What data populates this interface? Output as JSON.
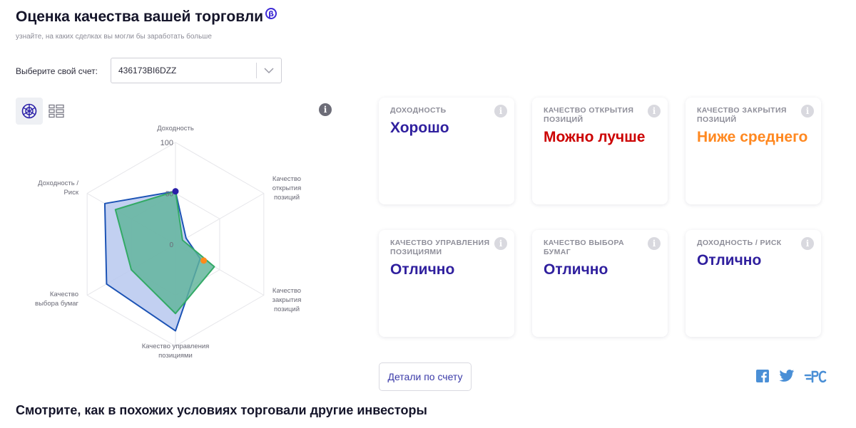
{
  "header": {
    "title": "Оценка качества вашей торговли",
    "beta": "β",
    "subtitle": "узнайте, на каких сделках вы могли бы заработать больше"
  },
  "account": {
    "label": "Выберите свой счет:",
    "value": "436173BI6DZZ"
  },
  "radar": {
    "axes": [
      "Доходность",
      "Качество открытия позиций",
      "Качество закрытия позиций",
      "Качество управления позициями",
      "Качество выбора бумаг",
      "Доходность / Риск"
    ],
    "axis_label_lines": [
      [
        "Доходность"
      ],
      [
        "Качество",
        "открытия",
        "позиций"
      ],
      [
        "Качество",
        "закрытия",
        "позиций"
      ],
      [
        "Качество управления",
        "позициями"
      ],
      [
        "Качество",
        "выбора бумаг"
      ],
      [
        "Доходность /",
        "Риск"
      ]
    ],
    "ticks": [
      "100",
      "50",
      "0"
    ],
    "series": [
      {
        "values": [
          52,
          12,
          28,
          85,
          78,
          80
        ],
        "fill": "#b7c8ee",
        "stroke": "#1c53b5"
      },
      {
        "values": [
          52,
          8,
          44,
          68,
          50,
          68
        ],
        "fill": "#5fb39a",
        "stroke": "#33aa66"
      }
    ],
    "markers": [
      {
        "axis": 0,
        "value": 52,
        "color": "#2a1fa8"
      },
      {
        "axis": 2,
        "value": 32,
        "color": "#ff8a1a"
      }
    ]
  },
  "cards": [
    {
      "label": "Доходность",
      "value": "Хорошо",
      "color": "#2f1f9e"
    },
    {
      "label": "Качество открытия позиций",
      "value": "Можно лучше",
      "color": "#cc0000"
    },
    {
      "label": "Качество закрытия позиций",
      "value": "Ниже среднего",
      "color": "#ff8820"
    },
    {
      "label": "Качество управления позициями",
      "value": "Отлично",
      "color": "#2f1f9e"
    },
    {
      "label": "Качество выбора бумаг",
      "value": "Отлично",
      "color": "#2f1f9e"
    },
    {
      "label": "Доходность / Риск",
      "value": "Отлично",
      "color": "#2f1f9e"
    }
  ],
  "details_button": "Детали по счету",
  "bottom_title": "Смотрите, как в похожих условиях торговали другие инвесторы",
  "icons": {
    "info": "i",
    "social": [
      "facebook-icon",
      "twitter-icon",
      "tradingview-icon"
    ]
  },
  "colors": {
    "brand": "#3e2bd6",
    "accent_blue": "#2f1f9e",
    "social": "#4a8fd6"
  }
}
